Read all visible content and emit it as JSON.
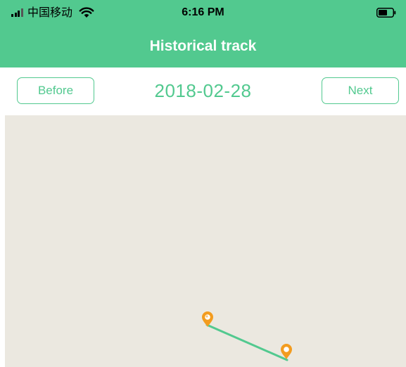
{
  "status_bar": {
    "carrier": "中国移动",
    "time": "6:16 PM",
    "icons": [
      "signal-icon",
      "wifi-icon",
      "battery-icon"
    ]
  },
  "nav": {
    "title": "Historical track"
  },
  "date_selector": {
    "before_label": "Before",
    "date": "2018-02-28",
    "next_label": "Next"
  },
  "map": {
    "background_color": "#ebe8e0",
    "track_color": "#52c98f",
    "marker_color": "#f39c1f",
    "markers": [
      "start-marker-icon",
      "end-marker-icon"
    ]
  },
  "colors": {
    "accent": "#52c98f",
    "header_text": "#ffffff"
  }
}
